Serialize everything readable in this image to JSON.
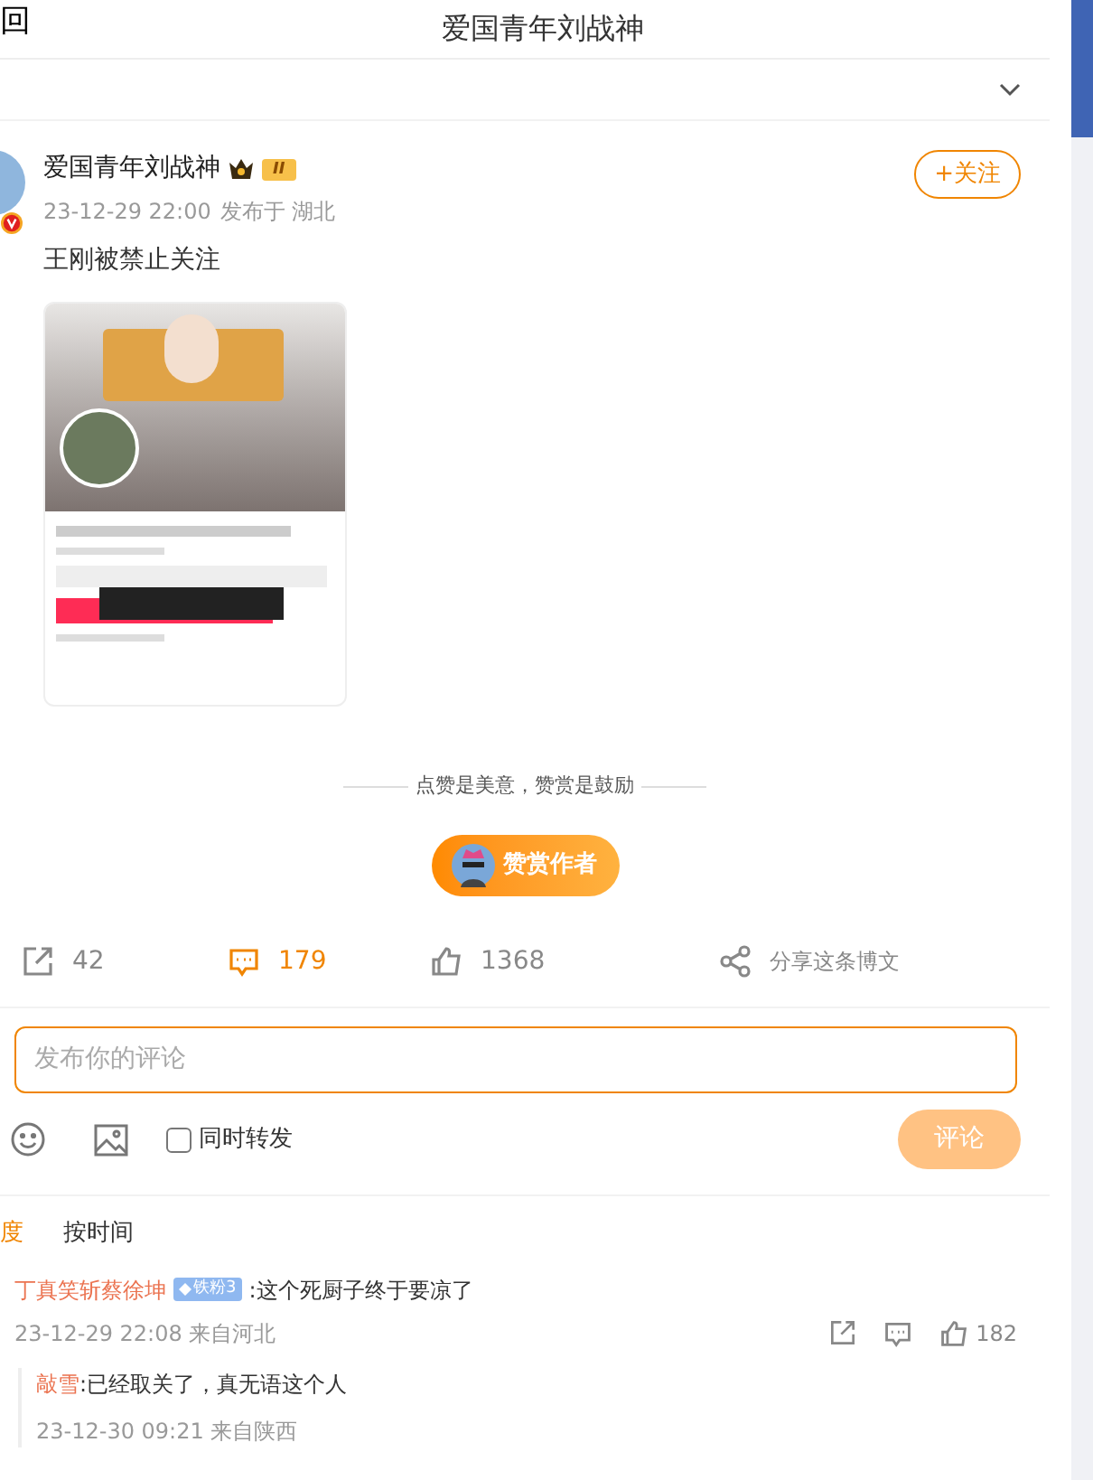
{
  "header": {
    "back": "回",
    "title": "爱国青年刘战神"
  },
  "post": {
    "author": "爱国青年刘战神",
    "badge": "II",
    "time": "23-12-29 22:00",
    "location": "发布于 湖北",
    "follow": "+关注",
    "text": "王刚被禁止关注",
    "reward_hint": "点赞是美意，赞赏是鼓励",
    "reward_button": "赞赏作者",
    "actions": [
      {
        "kind": "repost",
        "count": "42",
        "selected": false
      },
      {
        "kind": "comment",
        "count": "179",
        "selected": true
      },
      {
        "kind": "like",
        "count": "1368",
        "selected": false
      },
      {
        "kind": "share",
        "count": "分享这条博文",
        "selected": false
      }
    ]
  },
  "composer": {
    "placeholder": "发布你的评论",
    "repost_label": "同时转发",
    "repost_checked": false,
    "submit": "评论"
  },
  "sort_tabs": [
    {
      "label": "度",
      "selected": true
    },
    {
      "label": "按时间",
      "selected": false
    }
  ],
  "comments": [
    {
      "user": "丁真笑斩蔡徐坤",
      "fan_badge": "铁粉3",
      "text": ":这个死厨子终于要凉了",
      "meta": "23-12-29 22:08 来自河北",
      "likes": "182",
      "replies": [
        {
          "user": "敲雪",
          "text": ":已经取关了，真无语这个人",
          "meta": "23-12-30 09:21 来自陕西"
        }
      ]
    }
  ]
}
